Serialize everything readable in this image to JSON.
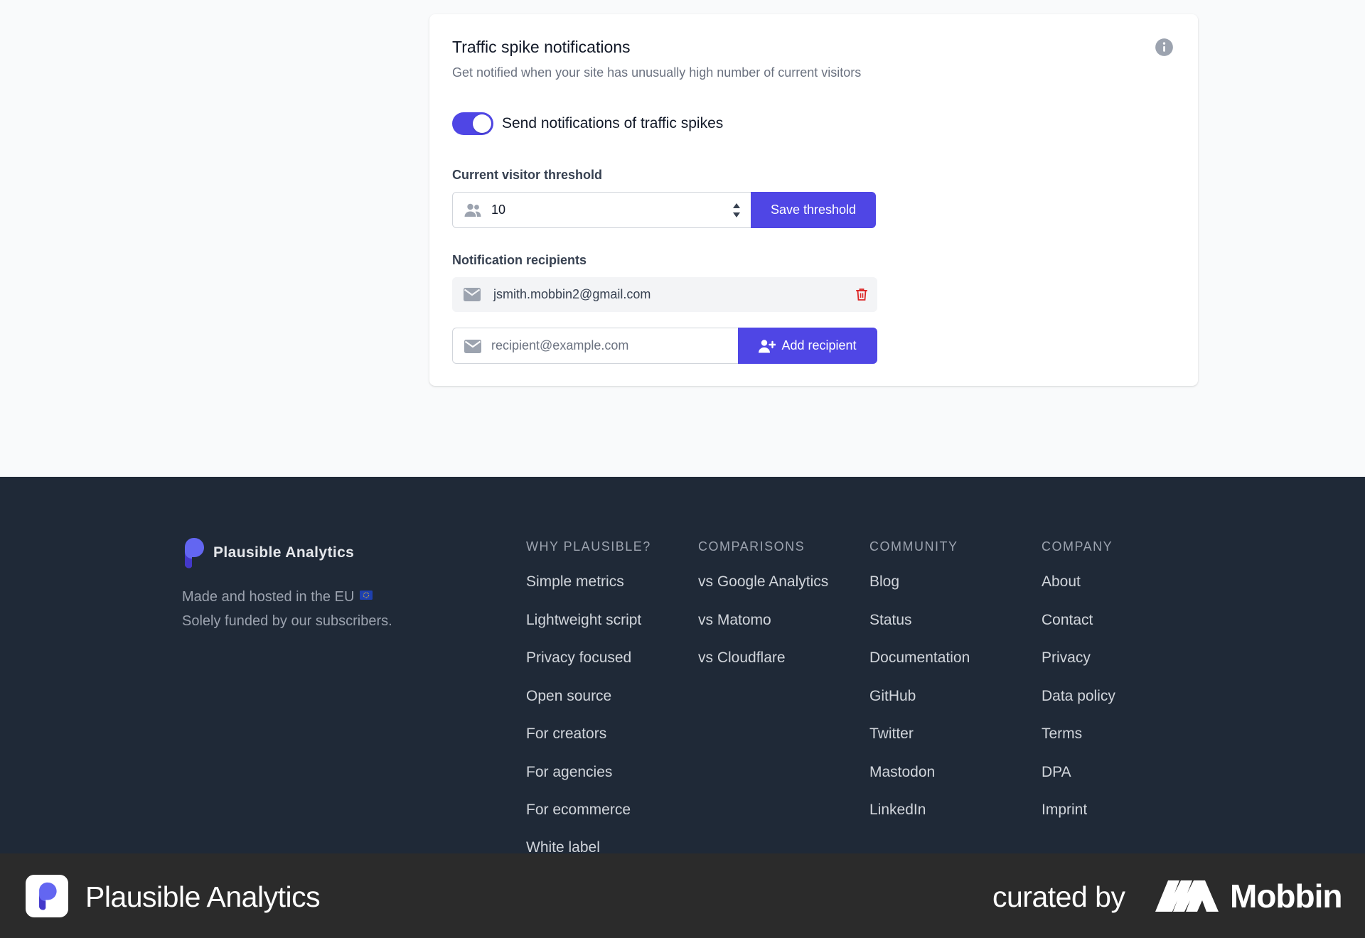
{
  "card": {
    "title": "Traffic spike notifications",
    "subtitle": "Get notified when your site has unusually high number of current visitors",
    "toggle_label": "Send notifications of traffic spikes",
    "toggle_on": true,
    "threshold_label": "Current visitor threshold",
    "threshold_value": "10",
    "save_button": "Save threshold",
    "recipients_label": "Notification recipients",
    "recipients": [
      "jsmith.mobbin2@gmail.com"
    ],
    "recipient_placeholder": "recipient@example.com",
    "add_button": "Add recipient"
  },
  "footer": {
    "brand": "Plausible Analytics",
    "tagline_1": "Made and hosted in the EU",
    "tagline_2": "Solely funded by our subscribers.",
    "columns": [
      {
        "heading": "WHY PLAUSIBLE?",
        "links": [
          "Simple metrics",
          "Lightweight script",
          "Privacy focused",
          "Open source",
          "For creators",
          "For agencies",
          "For ecommerce",
          "White label"
        ]
      },
      {
        "heading": "COMPARISONS",
        "links": [
          "vs Google Analytics",
          "vs Matomo",
          "vs Cloudflare"
        ]
      },
      {
        "heading": "COMMUNITY",
        "links": [
          "Blog",
          "Status",
          "Documentation",
          "GitHub",
          "Twitter",
          "Mastodon",
          "LinkedIn"
        ]
      },
      {
        "heading": "COMPANY",
        "links": [
          "About",
          "Contact",
          "Privacy",
          "Data policy",
          "Terms",
          "DPA",
          "Imprint"
        ]
      }
    ]
  },
  "bar": {
    "app_name": "Plausible Analytics",
    "curated_by": "curated by",
    "mobbin": "Mobbin"
  },
  "colors": {
    "accent": "#4f46e5",
    "footer_bg": "#1f2937",
    "danger": "#dc2626",
    "bar_bg": "#2b2b2b"
  },
  "icons": {
    "info": "info-icon",
    "threshold": "users-icon",
    "email": "envelope-icon",
    "delete": "trash-icon",
    "add": "user-plus-icon",
    "brand": "plausible-logo-icon",
    "eu": "eu-flag-icon"
  }
}
